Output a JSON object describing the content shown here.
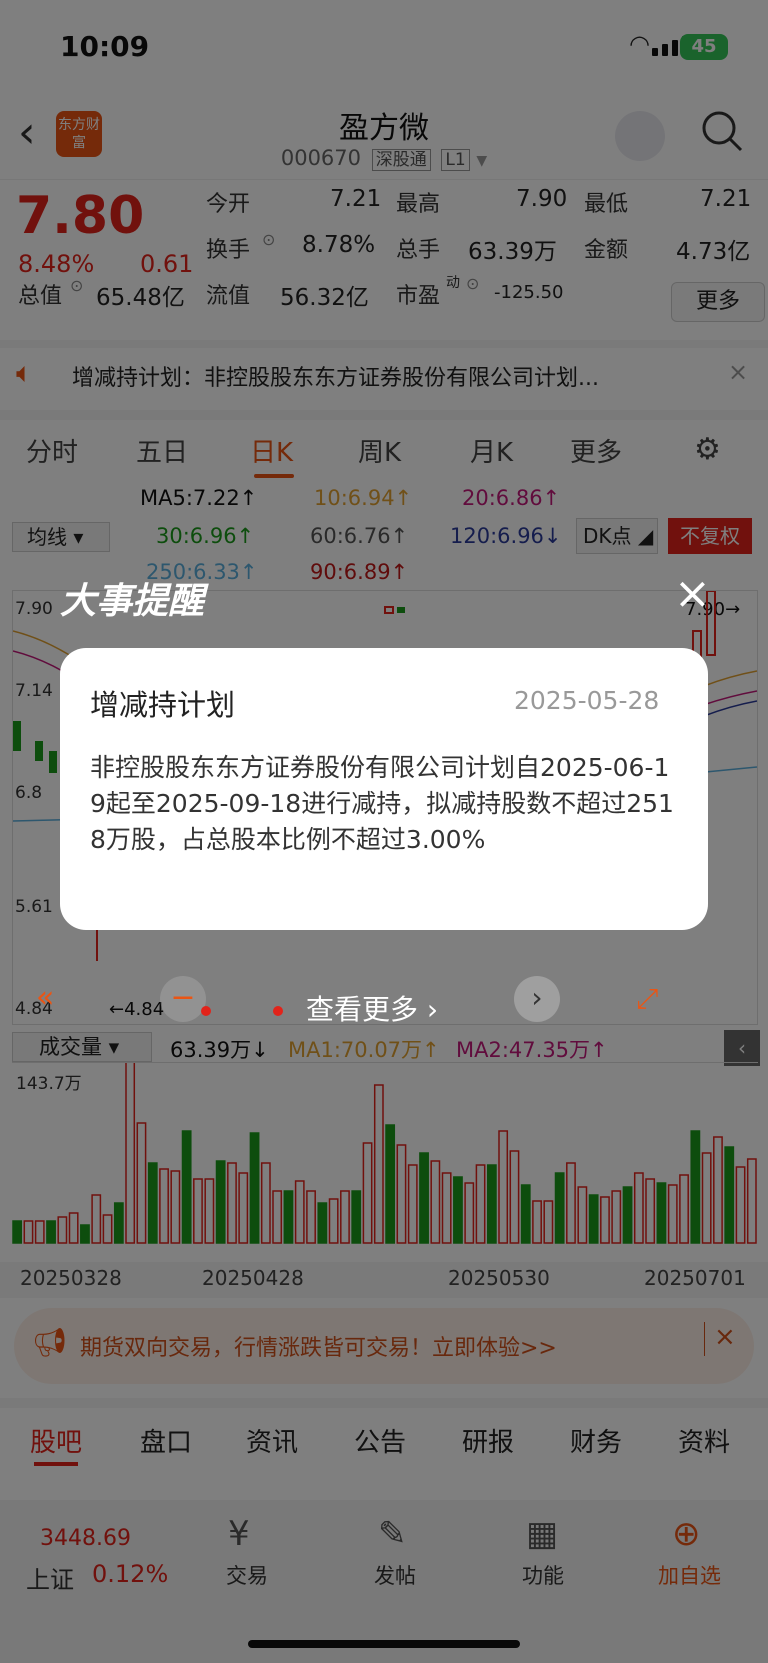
{
  "status": {
    "time": "10:09",
    "battery": "45"
  },
  "header": {
    "logo": "东方财富",
    "title": "盈方微",
    "code": "000670",
    "tag1": "深股通",
    "tag2": "L1"
  },
  "quote": {
    "price": "7.80",
    "pct": "8.48%",
    "change": "0.61",
    "open_label": "今开",
    "open": "7.21",
    "high_label": "最高",
    "high": "7.90",
    "low_label": "最低",
    "low": "7.21",
    "turnover_label": "换手",
    "turnover": "8.78%",
    "volume_label": "总手",
    "volume": "63.39万",
    "amount_label": "金额",
    "amount": "4.73亿",
    "mktcap_label": "总值",
    "mktcap": "65.48亿",
    "float_label": "流值",
    "float": "56.32亿",
    "pe_label": "市盈",
    "pe_sup": "动",
    "pe": "-125.50",
    "more": "更多"
  },
  "notice": {
    "text": "增减持计划：非控股股东东方证券股份有限公司计划..."
  },
  "tabs": [
    "分时",
    "五日",
    "日K",
    "周K",
    "月K",
    "更多"
  ],
  "ma": {
    "ma5": "MA5:7.22↑",
    "ma10": "10:6.94↑",
    "ma20": "20:6.86↑",
    "select": "均线",
    "ma30": "30:6.96↑",
    "ma60": "60:6.76↑",
    "ma120": "120:6.96↓",
    "dk": "DK点",
    "fq": "不复权",
    "ma250": "250:6.33↑",
    "ma90": "90:6.89↑"
  },
  "chart": {
    "y_top": "7.90",
    "y2": "7.14",
    "y3": "6.8",
    "y4": "5.61",
    "y_low": "4.84",
    "high_mark": "7.90→",
    "low_mark": "←4.84"
  },
  "overlay": {
    "banner": "大事提醒",
    "view_more": "查看更多"
  },
  "dialog": {
    "title": "增减持计划",
    "date": "2025-05-28",
    "body": "非控股股东东方证券股份有限公司计划自2025-06-19起至2025-09-18进行减持，拟减持股数不超过2518万股，占总股本比例不超过3.00%"
  },
  "volume": {
    "select": "成交量",
    "vol": "63.39万↓",
    "ma1": "MA1:70.07万↑",
    "ma2": "MA2:47.35万↑",
    "ymax": "143.7万"
  },
  "dates": [
    "20250328",
    "20250428",
    "20250530",
    "20250701"
  ],
  "promo": {
    "text": "期货双向交易，行情涨跌皆可交易！立即体验>>"
  },
  "subtabs": [
    "股吧",
    "盘口",
    "资讯",
    "公告",
    "研报",
    "财务",
    "资料"
  ],
  "nav": {
    "index_value": "3448.69",
    "index_name": "上证",
    "index_pct": "0.12%",
    "trade": "交易",
    "post": "发帖",
    "func": "功能",
    "add": "加自选"
  },
  "colors": {
    "red": "#e2231a",
    "green": "#1b9a1b",
    "orange": "#ea5514"
  }
}
